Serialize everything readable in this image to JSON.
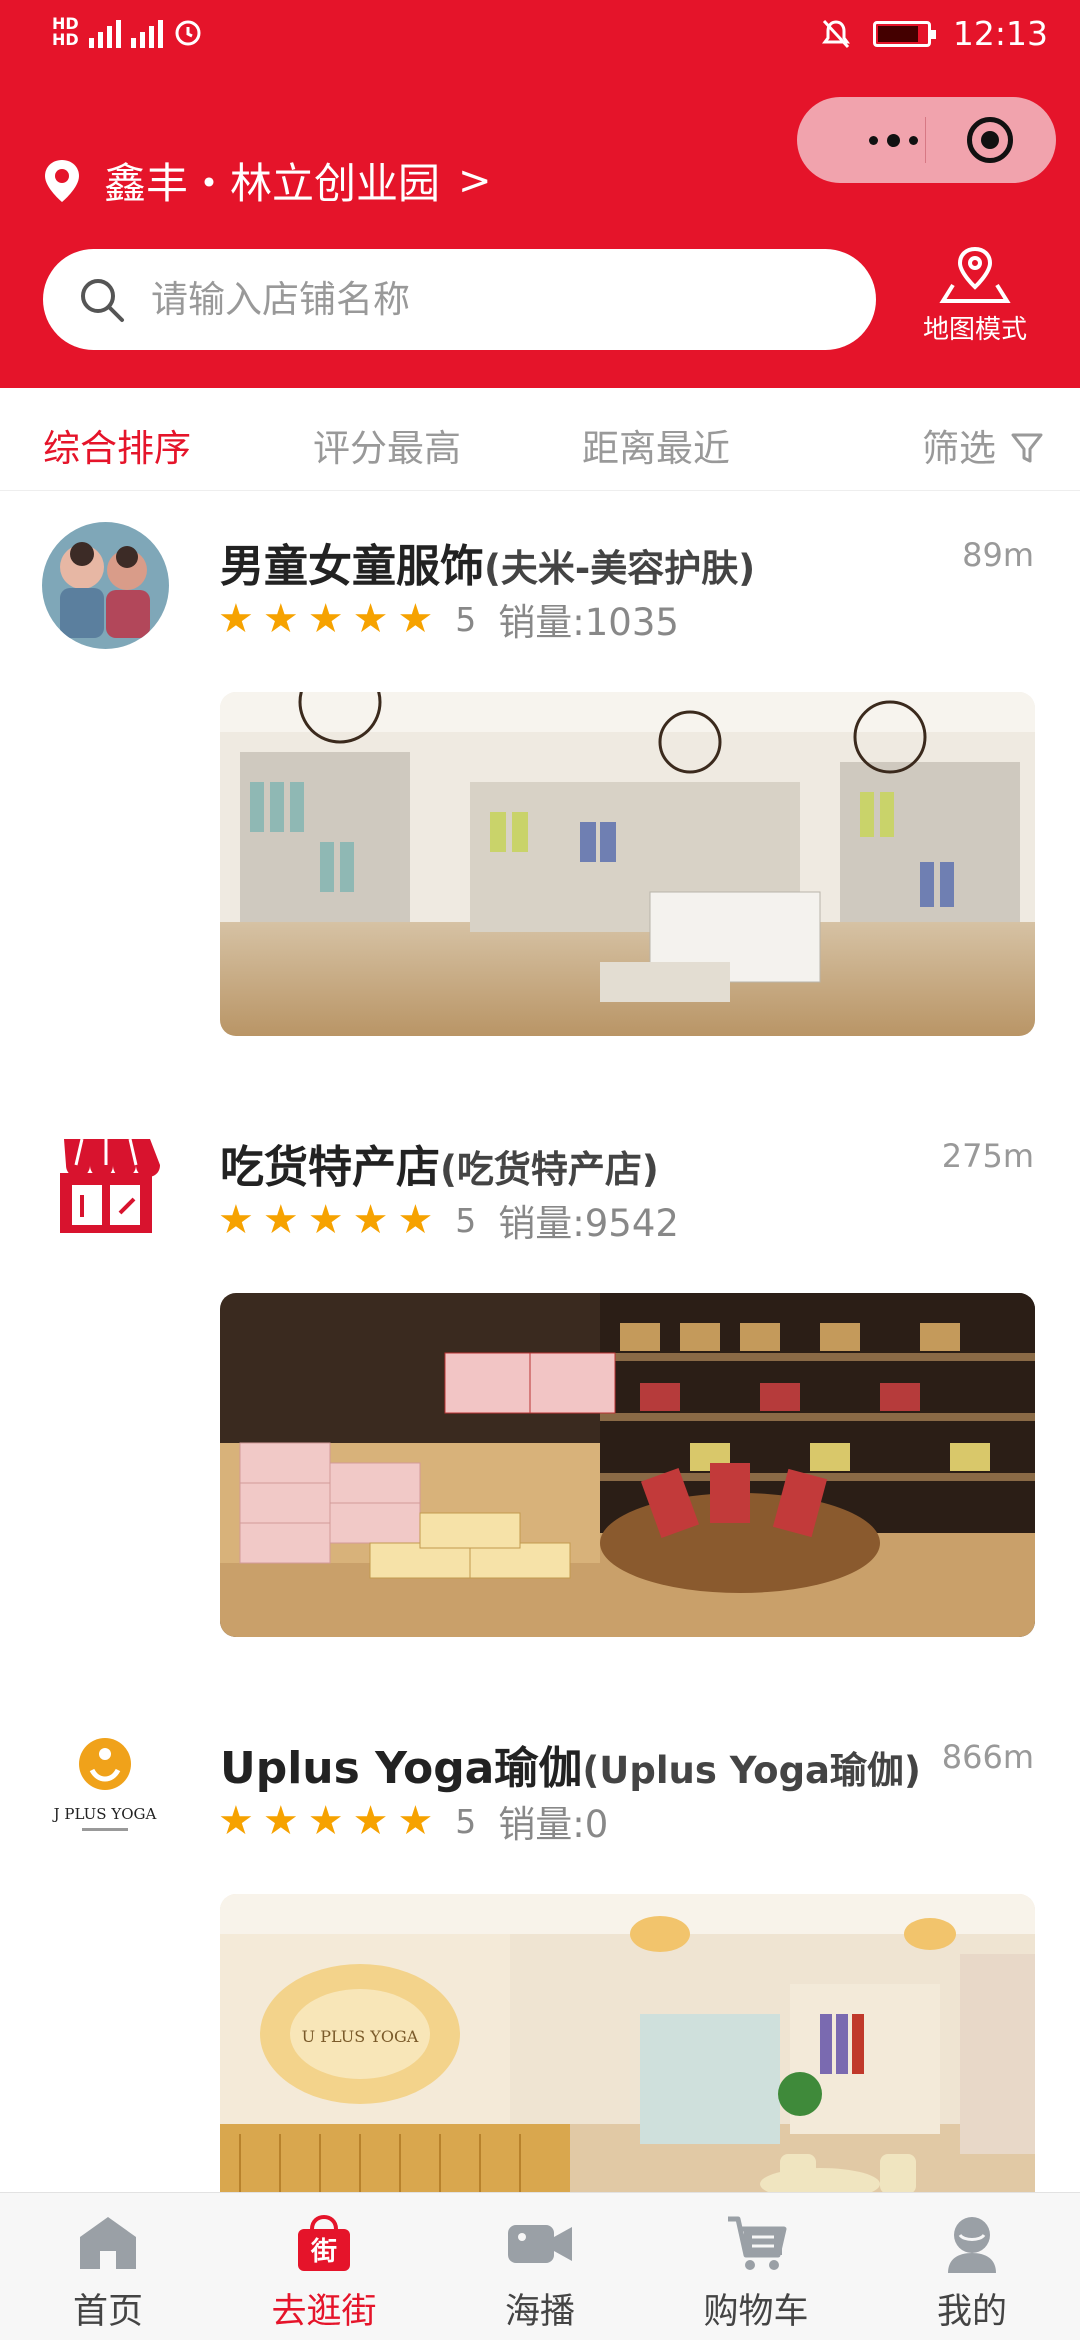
{
  "status_bar": {
    "left": "HD 46 46",
    "time": "12:13"
  },
  "location": {
    "name": "鑫丰・林立创业园",
    "chevron": ">"
  },
  "search": {
    "placeholder": "请输入店铺名称"
  },
  "map_mode": {
    "label": "地图模式"
  },
  "sort_tabs": [
    {
      "label": "综合排序",
      "active": true
    },
    {
      "label": "评分最高",
      "active": false
    },
    {
      "label": "距离最近",
      "active": false
    },
    {
      "label": "筛选",
      "active": false
    }
  ],
  "shops": [
    {
      "name": "男童女童服饰",
      "sub": "(夫米-美容护肤)",
      "distance": "89m",
      "score": "5",
      "sales": "销量:1035",
      "stars": 5
    },
    {
      "name": "吃货特产店",
      "sub": "(吃货特产店)",
      "distance": "275m",
      "score": "5",
      "sales": "销量:9542",
      "stars": 5
    },
    {
      "name": "Uplus Yoga瑜伽",
      "sub": "(Uplus Yoga瑜伽)",
      "distance": "866m",
      "score": "5",
      "sales": "销量:0",
      "stars": 5
    }
  ],
  "logos": {
    "shop3_text": "J PLUS YOGA",
    "shop3_sign": "U PLUS YOGA"
  },
  "tabbar": [
    {
      "label": "首页",
      "icon": "home-icon"
    },
    {
      "label": "去逛街",
      "icon": "shop-bag-icon",
      "active": true
    },
    {
      "label": "海播",
      "icon": "video-camera-icon"
    },
    {
      "label": "购物车",
      "icon": "cart-icon"
    },
    {
      "label": "我的",
      "icon": "user-icon"
    }
  ],
  "colors": {
    "brand_red": "#e5142a",
    "star": "#f6a200",
    "muted": "#999999"
  }
}
